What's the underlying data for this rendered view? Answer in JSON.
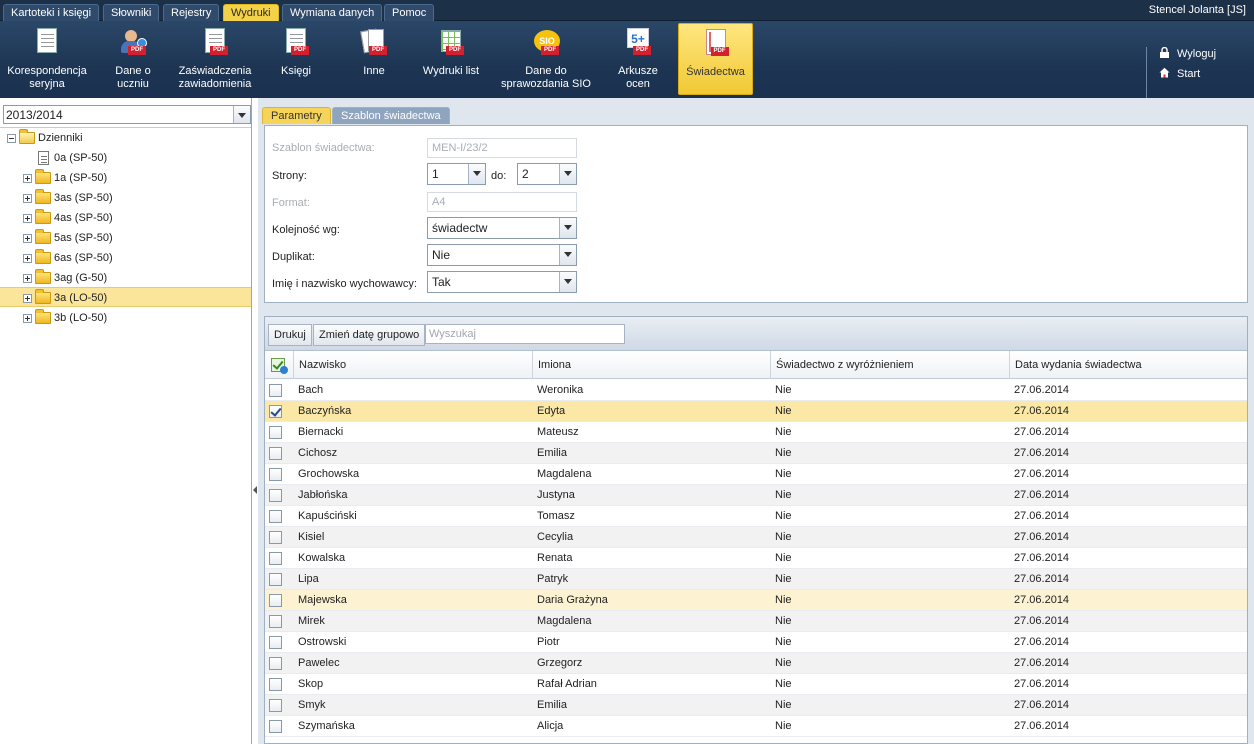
{
  "menu": [
    "Kartoteki i księgi",
    "Słowniki",
    "Rejestry",
    "Wydruki",
    "Wymiana danych",
    "Pomoc"
  ],
  "menu_active": "Wydruki",
  "user": "Stencel Jolanta [JS]",
  "toolbar": {
    "korespondencja": "Korespondencja seryjna",
    "dane_ucznia": "Dane o uczniu",
    "zaswiadczenia": "Zaświadczenia zawiadomienia",
    "ksiegi": "Księgi",
    "inne": "Inne",
    "wydruki_list": "Wydruki list",
    "sio": "Dane do sprawozdania SIO",
    "arkusze": "Arkusze ocen",
    "swiadectwa": "Świadectwa",
    "pdf_badge": "PDF",
    "sio_badge": "SIO",
    "arkusze_badge": "5+"
  },
  "right_menu": {
    "logout": "Wyloguj",
    "start": "Start"
  },
  "left": {
    "year": "2013/2014",
    "root": "Dzienniki",
    "nodes": [
      "0a (SP-50)",
      "1a (SP-50)",
      "3as (SP-50)",
      "4as (SP-50)",
      "5as (SP-50)",
      "6as (SP-50)",
      "3ag (G-50)",
      "3a (LO-50)",
      "3b (LO-50)"
    ],
    "selected": "3a (LO-50)"
  },
  "tabs": {
    "parametry": "Parametry",
    "szablon": "Szablon świadectwa"
  },
  "params": {
    "szablon_label": "Szablon świadectwa:",
    "szablon_value": "MEN-I/23/2",
    "strony_label": "Strony:",
    "strony_from": "1",
    "do_label": "do:",
    "strony_to": "2",
    "format_label": "Format:",
    "format_value": "A4",
    "kolejnosc_label": "Kolejność wg:",
    "kolejnosc_value": "świadectw",
    "duplikat_label": "Duplikat:",
    "duplikat_value": "Nie",
    "imie_label": "Imię i nazwisko wychowawcy:",
    "imie_value": "Tak"
  },
  "grid": {
    "print_button": "Drukuj",
    "change_date_button": "Zmień datę grupowo",
    "search_placeholder": "Wyszukaj",
    "columns": [
      "Nazwisko",
      "Imiona",
      "Świadectwo z wyróżnieniem",
      "Data wydania świadectwa"
    ],
    "rows": [
      {
        "nazwisko": "Bach",
        "imiona": "Weronika",
        "wyroznienie": "Nie",
        "data": "27.06.2014",
        "checked": false
      },
      {
        "nazwisko": "Baczyńska",
        "imiona": "Edyta",
        "wyroznienie": "Nie",
        "data": "27.06.2014",
        "checked": true
      },
      {
        "nazwisko": "Biernacki",
        "imiona": "Mateusz",
        "wyroznienie": "Nie",
        "data": "27.06.2014",
        "checked": false
      },
      {
        "nazwisko": "Cichosz",
        "imiona": "Emilia",
        "wyroznienie": "Nie",
        "data": "27.06.2014",
        "checked": false
      },
      {
        "nazwisko": "Grochowska",
        "imiona": "Magdalena",
        "wyroznienie": "Nie",
        "data": "27.06.2014",
        "checked": false
      },
      {
        "nazwisko": "Jabłońska",
        "imiona": "Justyna",
        "wyroznienie": "Nie",
        "data": "27.06.2014",
        "checked": false
      },
      {
        "nazwisko": "Kapuściński",
        "imiona": "Tomasz",
        "wyroznienie": "Nie",
        "data": "27.06.2014",
        "checked": false
      },
      {
        "nazwisko": "Kisiel",
        "imiona": "Cecylia",
        "wyroznienie": "Nie",
        "data": "27.06.2014",
        "checked": false
      },
      {
        "nazwisko": "Kowalska",
        "imiona": "Renata",
        "wyroznienie": "Nie",
        "data": "27.06.2014",
        "checked": false
      },
      {
        "nazwisko": "Lipa",
        "imiona": "Patryk",
        "wyroznienie": "Nie",
        "data": "27.06.2014",
        "checked": false
      },
      {
        "nazwisko": "Majewska",
        "imiona": "Daria Grażyna",
        "wyroznienie": "Nie",
        "data": "27.06.2014",
        "checked": false
      },
      {
        "nazwisko": "Mirek",
        "imiona": "Magdalena",
        "wyroznienie": "Nie",
        "data": "27.06.2014",
        "checked": false
      },
      {
        "nazwisko": "Ostrowski",
        "imiona": "Piotr",
        "wyroznienie": "Nie",
        "data": "27.06.2014",
        "checked": false
      },
      {
        "nazwisko": "Pawelec",
        "imiona": "Grzegorz",
        "wyroznienie": "Nie",
        "data": "27.06.2014",
        "checked": false
      },
      {
        "nazwisko": "Skop",
        "imiona": "Rafał Adrian",
        "wyroznienie": "Nie",
        "data": "27.06.2014",
        "checked": false
      },
      {
        "nazwisko": "Smyk",
        "imiona": "Emilia",
        "wyroznienie": "Nie",
        "data": "27.06.2014",
        "checked": false
      },
      {
        "nazwisko": "Szymańska",
        "imiona": "Alicja",
        "wyroznienie": "Nie",
        "data": "27.06.2014",
        "checked": false
      }
    ]
  },
  "colors": {
    "accent": "#f3d24a",
    "header_bg": "#1c3048",
    "selected_row": "#fbe8a6"
  }
}
